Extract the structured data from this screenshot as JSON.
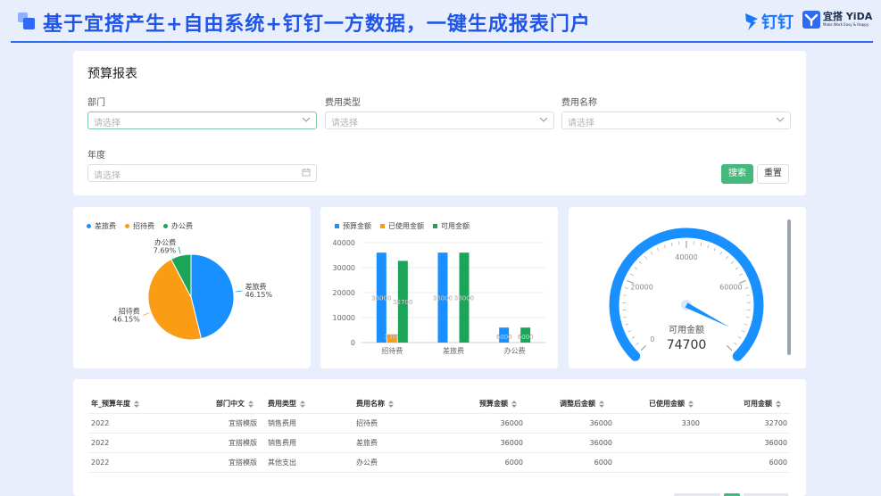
{
  "banner": {
    "title": "基于宜搭产生+自由系统+钉钉一方数据，一键生成报表门户",
    "dingtalk_logo": "钉钉",
    "yida_name": "宜搭 YiDA",
    "yida_slogan": "Make Work Easy & Happy",
    "accent_color": "#1f55e8"
  },
  "filters": {
    "title": "预算报表",
    "department": {
      "label": "部门",
      "placeholder": "请选择"
    },
    "expense_type": {
      "label": "费用类型",
      "placeholder": "请选择"
    },
    "expense_name": {
      "label": "费用名称",
      "placeholder": "请选择"
    },
    "year": {
      "label": "年度",
      "placeholder": "请选择"
    },
    "search_label": "搜索",
    "reset_label": "重置"
  },
  "chart_data": [
    {
      "type": "pie",
      "legend": [
        "差旅费",
        "招待费",
        "办公费"
      ],
      "slices": [
        {
          "name": "差旅费",
          "value": 46.15,
          "label": "46.15%",
          "color": "#1890ff"
        },
        {
          "name": "招待费",
          "value": 46.15,
          "label": "46.15%",
          "color": "#fa9d14"
        },
        {
          "name": "办公费",
          "value": 7.69,
          "label": "7.69%",
          "color": "#1aa558"
        }
      ],
      "legend_position": "top-left"
    },
    {
      "type": "bar",
      "categories": [
        "招待费",
        "差旅费",
        "办公费"
      ],
      "series": [
        {
          "name": "预算金额",
          "values": [
            36000,
            36000,
            6000
          ],
          "labels": [
            "36000",
            "36000",
            "6000"
          ],
          "color": "#1890ff"
        },
        {
          "name": "已使用金额",
          "values": [
            3300,
            0,
            0
          ],
          "labels": [
            "3300",
            "",
            ""
          ],
          "color": "#fa9d14"
        },
        {
          "name": "可用金额",
          "values": [
            32700,
            36000,
            6000
          ],
          "labels": [
            "32700",
            "36000",
            "6000"
          ],
          "color": "#1aa558"
        }
      ],
      "yticks": [
        "0",
        "10000",
        "20000",
        "30000",
        "40000"
      ],
      "ylim": [
        0,
        40000
      ],
      "grid": true,
      "legend_position": "top-left"
    },
    {
      "type": "gauge",
      "title": "可用金额",
      "value": 74700,
      "value_label": "74700",
      "min": 0,
      "max": 80000,
      "ticks": [
        "0",
        "20000",
        "40000",
        "60000"
      ],
      "color": "#1890ff"
    }
  ],
  "table": {
    "columns": [
      "年_预算年度",
      "部门中文",
      "费用类型",
      "费用名称",
      "预算金额",
      "调整后金额",
      "已使用金额",
      "可用金额"
    ],
    "rows": [
      [
        "2022",
        "宜搭模版",
        "销售费用",
        "招待费",
        "36000",
        "36000",
        "3300",
        "32700"
      ],
      [
        "2022",
        "宜搭模版",
        "销售费用",
        "差旅费",
        "36000",
        "36000",
        "",
        "36000"
      ],
      [
        "2022",
        "宜搭模版",
        "其他支出",
        "办公费",
        "6000",
        "6000",
        "",
        "6000"
      ]
    ]
  }
}
